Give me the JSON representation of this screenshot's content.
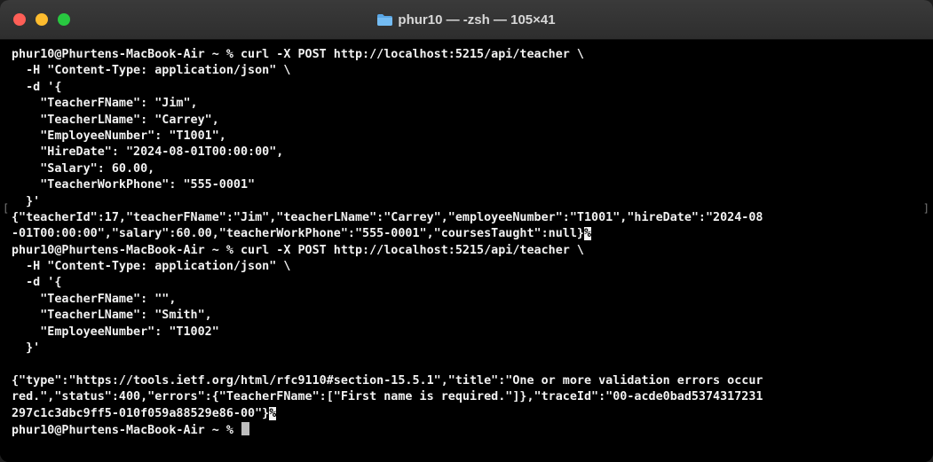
{
  "window": {
    "title": "phur10 — -zsh — 105×41",
    "folder_icon": "folder-icon"
  },
  "colors": {
    "background": "#000000",
    "text": "#f2f2f2",
    "close": "#ff5f57",
    "minimize": "#febc2e",
    "maximize": "#28c840"
  },
  "terminal": {
    "lines": [
      "phur10@Phurtens-MacBook-Air ~ % curl -X POST http://localhost:5215/api/teacher \\",
      "  -H \"Content-Type: application/json\" \\",
      "  -d '{",
      "    \"TeacherFName\": \"Jim\",",
      "    \"TeacherLName\": \"Carrey\",",
      "    \"EmployeeNumber\": \"T1001\",",
      "    \"HireDate\": \"2024-08-01T00:00:00\",",
      "    \"Salary\": 60.00,",
      "    \"TeacherWorkPhone\": \"555-0001\"",
      "  }'",
      "{\"teacherId\":17,\"teacherFName\":\"Jim\",\"teacherLName\":\"Carrey\",\"employeeNumber\":\"T1001\",\"hireDate\":\"2024-08",
      "-01T00:00:00\",\"salary\":60.00,\"teacherWorkPhone\":\"555-0001\",\"coursesTaught\":null}",
      "phur10@Phurtens-MacBook-Air ~ % curl -X POST http://localhost:5215/api/teacher \\",
      "  -H \"Content-Type: application/json\" \\",
      "  -d '{",
      "    \"TeacherFName\": \"\",",
      "    \"TeacherLName\": \"Smith\",",
      "    \"EmployeeNumber\": \"T1002\"",
      "  }'",
      "",
      "{\"type\":\"https://tools.ietf.org/html/rfc9110#section-15.5.1\",\"title\":\"One or more validation errors occur",
      "red.\",\"status\":400,\"errors\":{\"TeacherFName\":[\"First name is required.\"]},\"traceId\":\"00-acde0bad5374317231",
      "297c1c3dbc9ff5-010f059a88529e86-00\"}",
      "phur10@Phurtens-MacBook-Air ~ % "
    ],
    "end_marker": "%",
    "bracket_left": "[",
    "bracket_right": "]"
  }
}
